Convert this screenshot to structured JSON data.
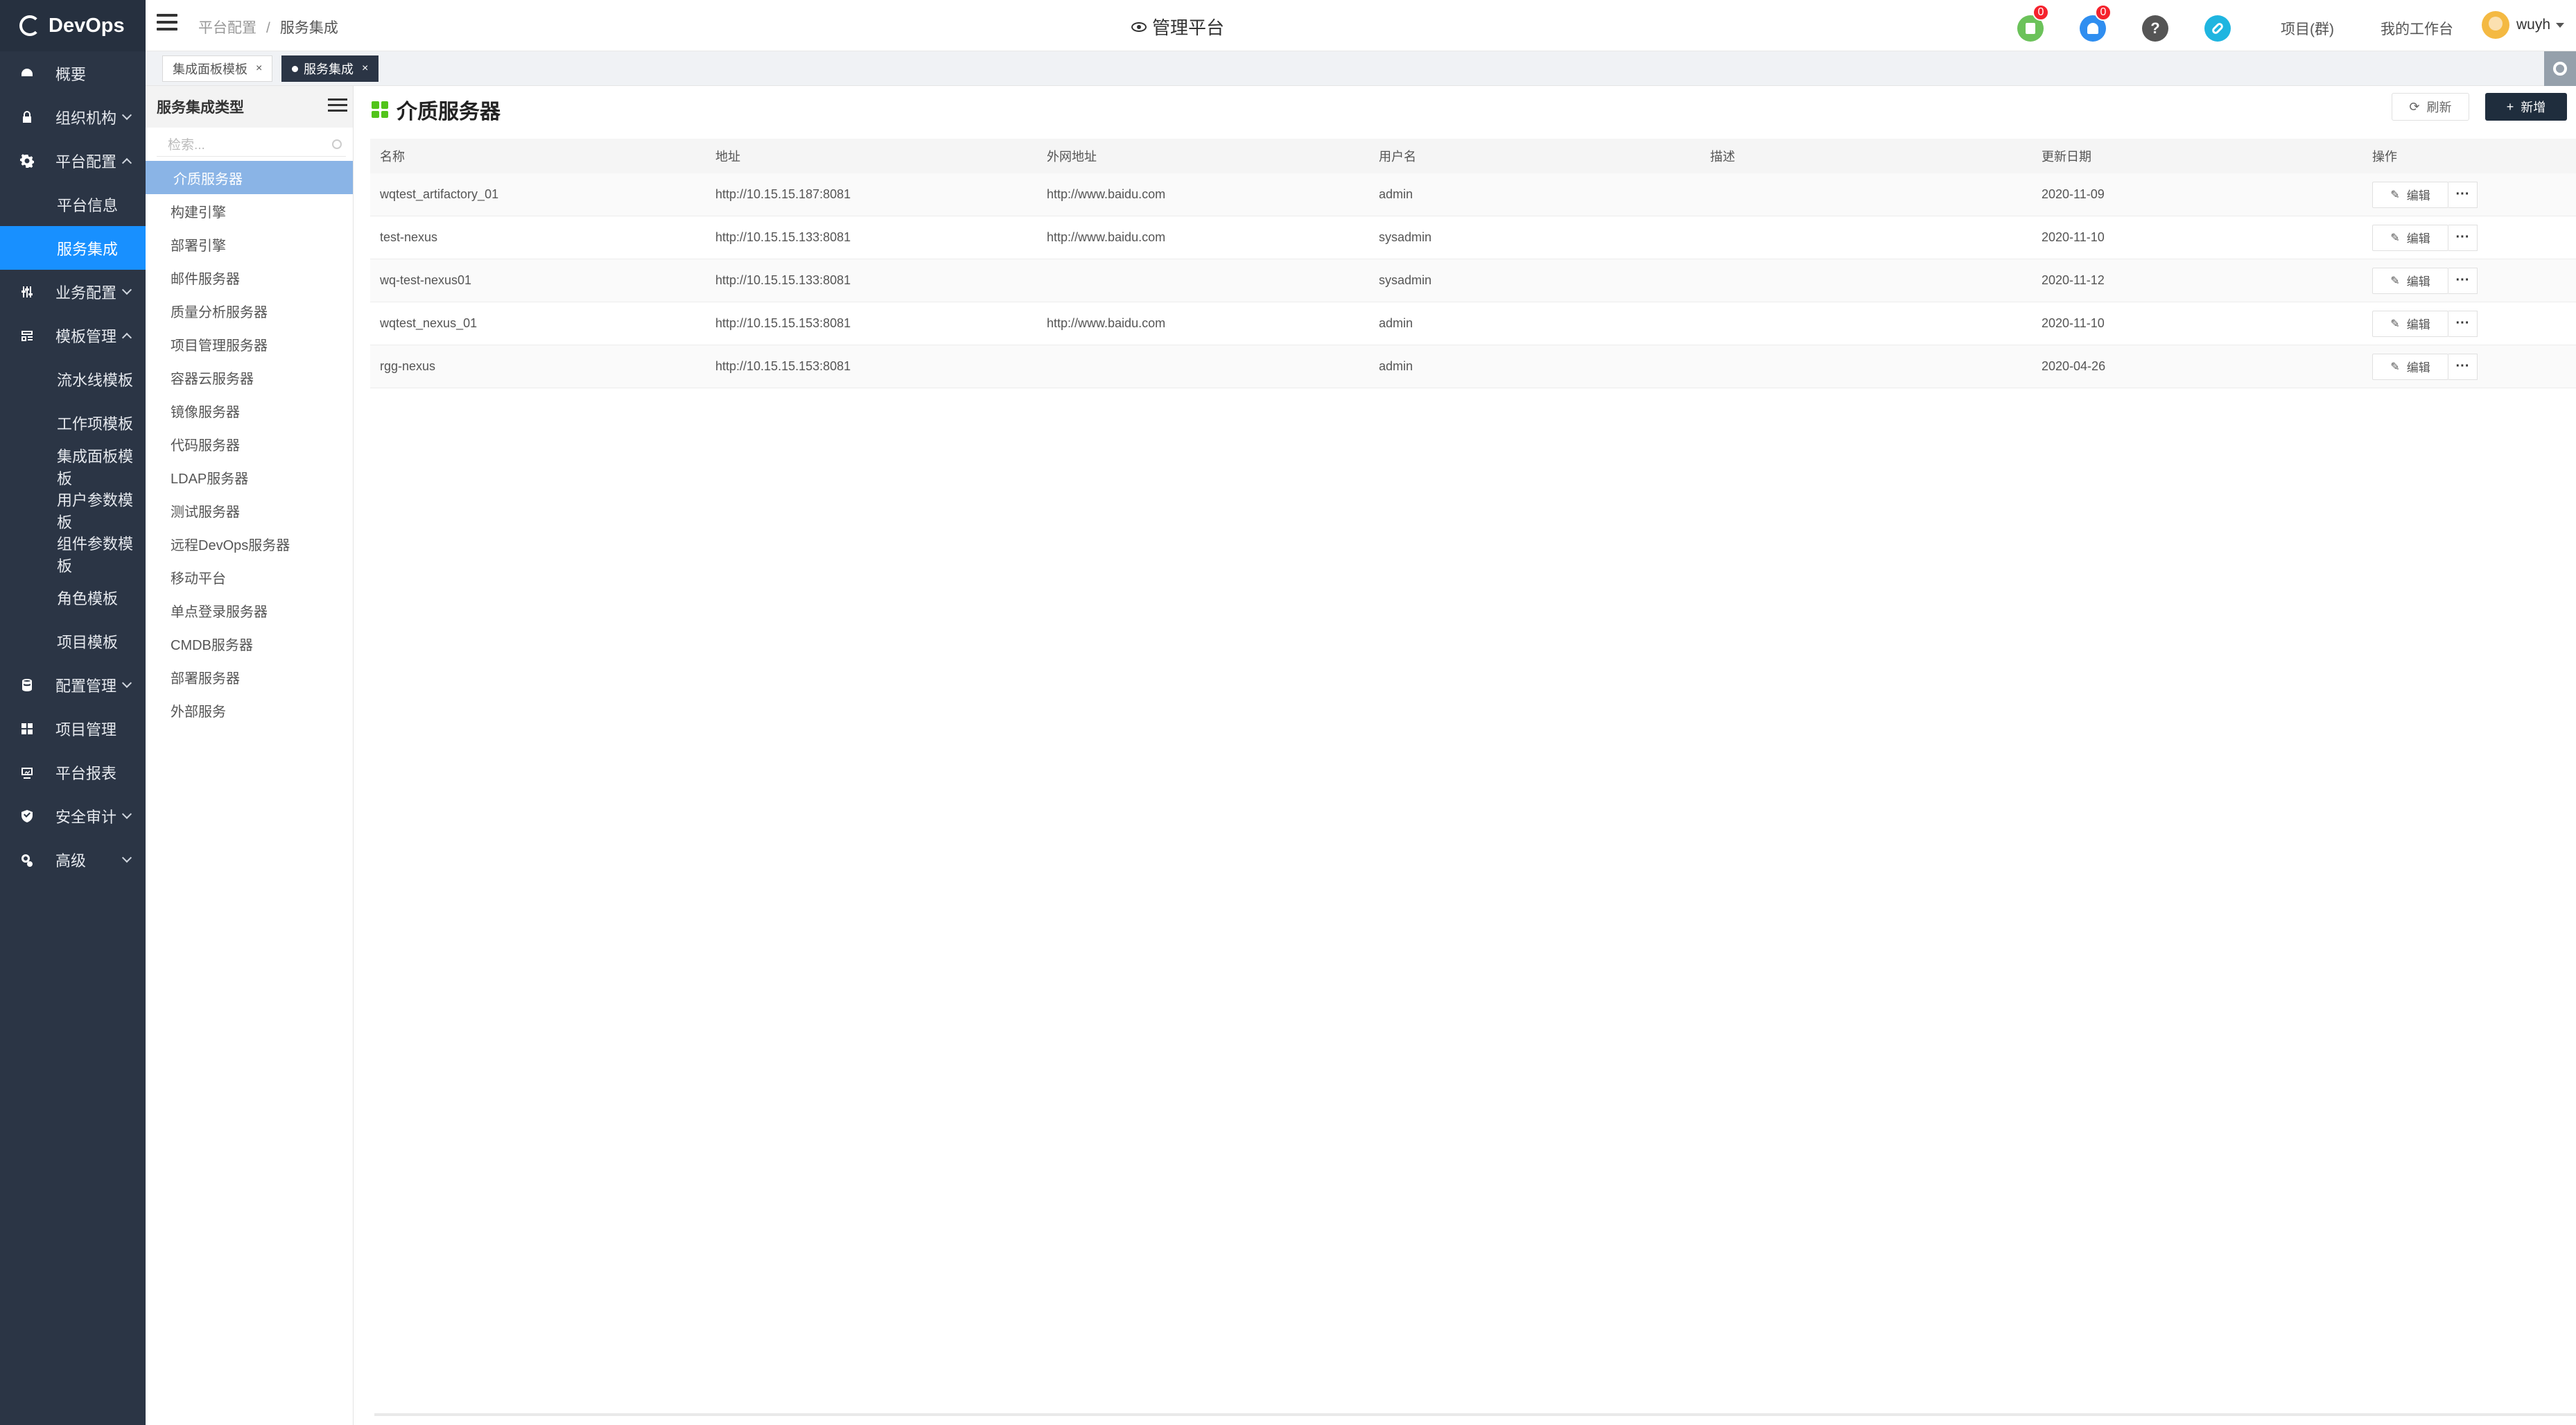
{
  "app": {
    "logo_text": "DevOps"
  },
  "nav": {
    "items": [
      {
        "label": "概要",
        "icon": "dashboard-icon"
      },
      {
        "label": "组织机构",
        "icon": "lock-icon",
        "expandable": true
      },
      {
        "label": "平台配置",
        "icon": "gear-icon",
        "expanded": true
      },
      {
        "label": "平台信息",
        "sub": true
      },
      {
        "label": "服务集成",
        "sub": true,
        "active": true
      },
      {
        "label": "业务配置",
        "icon": "sliders-icon",
        "expandable": true
      },
      {
        "label": "模板管理",
        "icon": "template-icon",
        "expanded": true
      },
      {
        "label": "流水线模板",
        "sub": true
      },
      {
        "label": "工作项模板",
        "sub": true
      },
      {
        "label": "集成面板模板",
        "sub": true
      },
      {
        "label": "用户参数模板",
        "sub": true
      },
      {
        "label": "组件参数模板",
        "sub": true
      },
      {
        "label": "角色模板",
        "sub": true
      },
      {
        "label": "项目模板",
        "sub": true
      },
      {
        "label": "配置管理",
        "icon": "database-icon",
        "expandable": true
      },
      {
        "label": "项目管理",
        "icon": "grid-icon"
      },
      {
        "label": "平台报表",
        "icon": "report-icon"
      },
      {
        "label": "安全审计",
        "icon": "shield-icon",
        "expandable": true
      },
      {
        "label": "高级",
        "icon": "advanced-icon",
        "expandable": true
      }
    ]
  },
  "header": {
    "breadcrumb": [
      "平台配置",
      "服务集成"
    ],
    "center_title": "管理平台",
    "doc_badge": "0",
    "bell_badge": "0",
    "help_symbol": "?",
    "project_group_link": "项目(群)",
    "workspace_link": "我的工作台",
    "username": "wuyh",
    "colors": {
      "doc": "#6bc25a",
      "bell": "#2f8ef0",
      "help": "#555555",
      "link": "#1fb5e0"
    }
  },
  "tabs": [
    {
      "label": "集成面板模板",
      "close": "×"
    },
    {
      "label": "服务集成",
      "close": "×",
      "active": true
    }
  ],
  "category_panel": {
    "title": "服务集成类型",
    "search_placeholder": "检索...",
    "items": [
      "介质服务器",
      "构建引擎",
      "部署引擎",
      "邮件服务器",
      "质量分析服务器",
      "项目管理服务器",
      "容器云服务器",
      "镜像服务器",
      "代码服务器",
      "LDAP服务器",
      "测试服务器",
      "远程DevOps服务器",
      "移动平台",
      "单点登录服务器",
      "CMDB服务器",
      "部署服务器",
      "外部服务"
    ]
  },
  "main": {
    "title": "介质服务器",
    "refresh_label": "刷新",
    "add_label": "新增",
    "table": {
      "headers": [
        "名称",
        "地址",
        "外网地址",
        "用户名",
        "描述",
        "更新日期",
        "操作"
      ],
      "rows": [
        [
          "wqtest_artifactory_01",
          "http://10.15.15.187:8081",
          "http://www.baidu.com",
          "admin",
          "",
          "2020-11-09"
        ],
        [
          "test-nexus",
          "http://10.15.15.133:8081",
          "http://www.baidu.com",
          "sysadmin",
          "",
          "2020-11-10"
        ],
        [
          "wq-test-nexus01",
          "http://10.15.15.133:8081",
          "",
          "sysadmin",
          "",
          "2020-11-12"
        ],
        [
          "wqtest_nexus_01",
          "http://10.15.15.153:8081",
          "http://www.baidu.com",
          "admin",
          "",
          "2020-11-10"
        ],
        [
          "rgg-nexus",
          "http://10.15.15.153:8081",
          "",
          "admin",
          "",
          "2020-04-26"
        ]
      ],
      "edit_label": "编辑",
      "more_label": "···"
    }
  }
}
